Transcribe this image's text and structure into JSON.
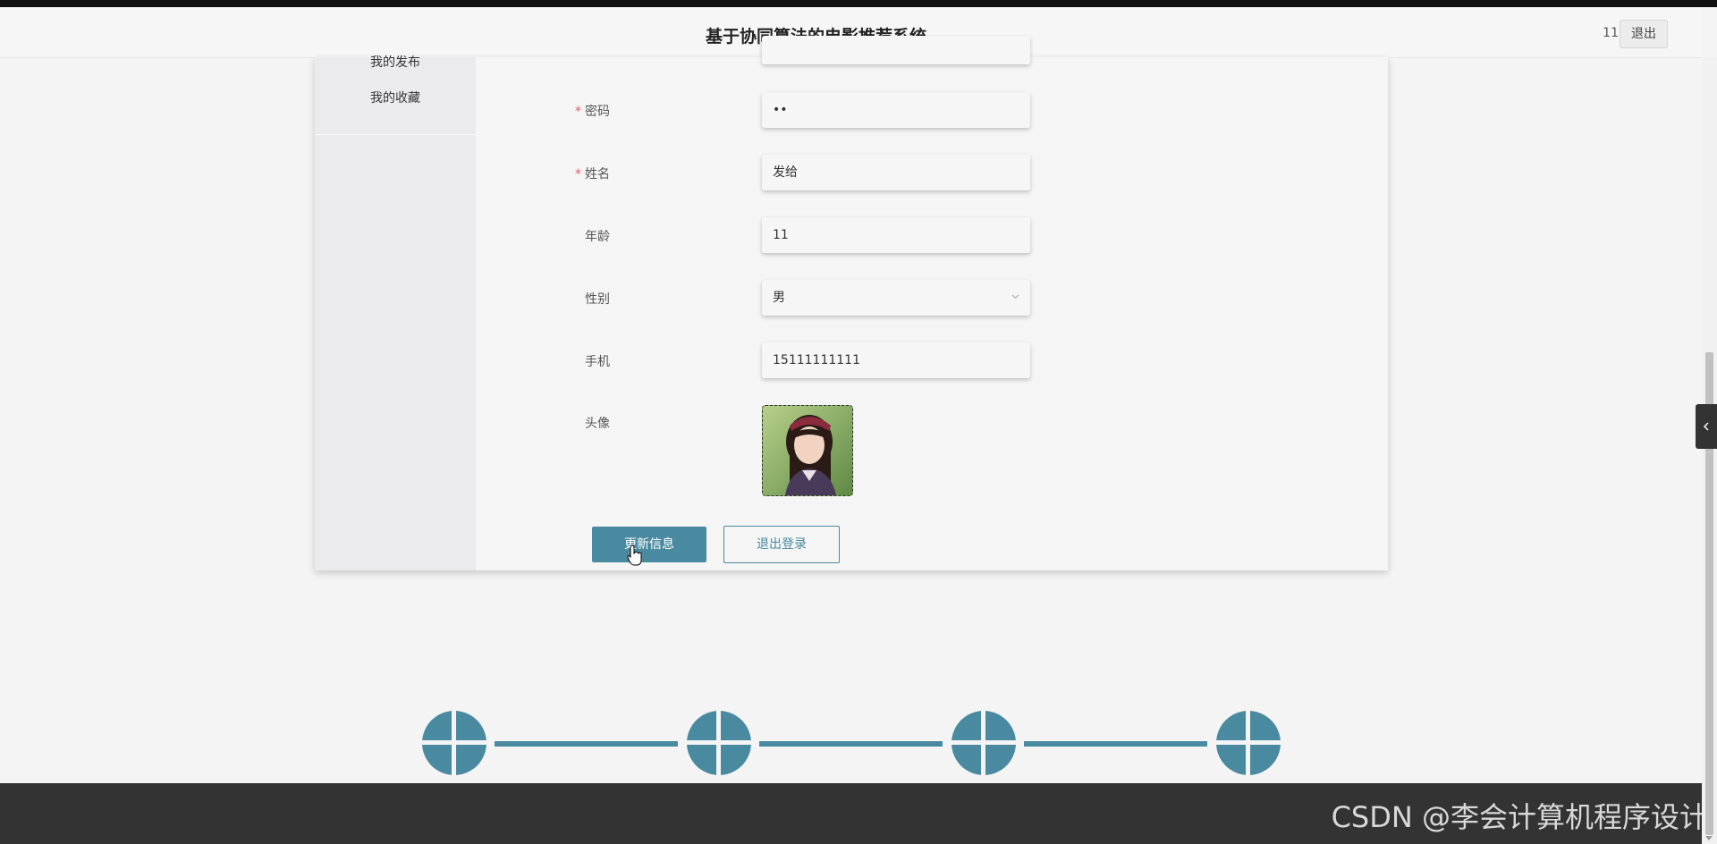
{
  "header": {
    "title": "基于协同算法的电影推荐系统",
    "user": "11",
    "logout_label": "退出"
  },
  "sidebar": {
    "items": [
      {
        "label": "我的发布"
      },
      {
        "label": "我的收藏"
      }
    ]
  },
  "form": {
    "password": {
      "label": "密码",
      "value": "••",
      "required": true
    },
    "name": {
      "label": "姓名",
      "value": "发给",
      "required": true
    },
    "age": {
      "label": "年龄",
      "value": "11"
    },
    "gender": {
      "label": "性别",
      "value": "男"
    },
    "phone": {
      "label": "手机",
      "value": "15111111111"
    },
    "avatar": {
      "label": "头像"
    },
    "required_mark": "*"
  },
  "actions": {
    "update_label": "更新信息",
    "logout_label": "退出登录"
  },
  "watermark": "CSDN @李会计算机程序设计",
  "colors": {
    "accent": "#4a8aa0",
    "footer": "#333333",
    "required": "#e25c5c"
  }
}
